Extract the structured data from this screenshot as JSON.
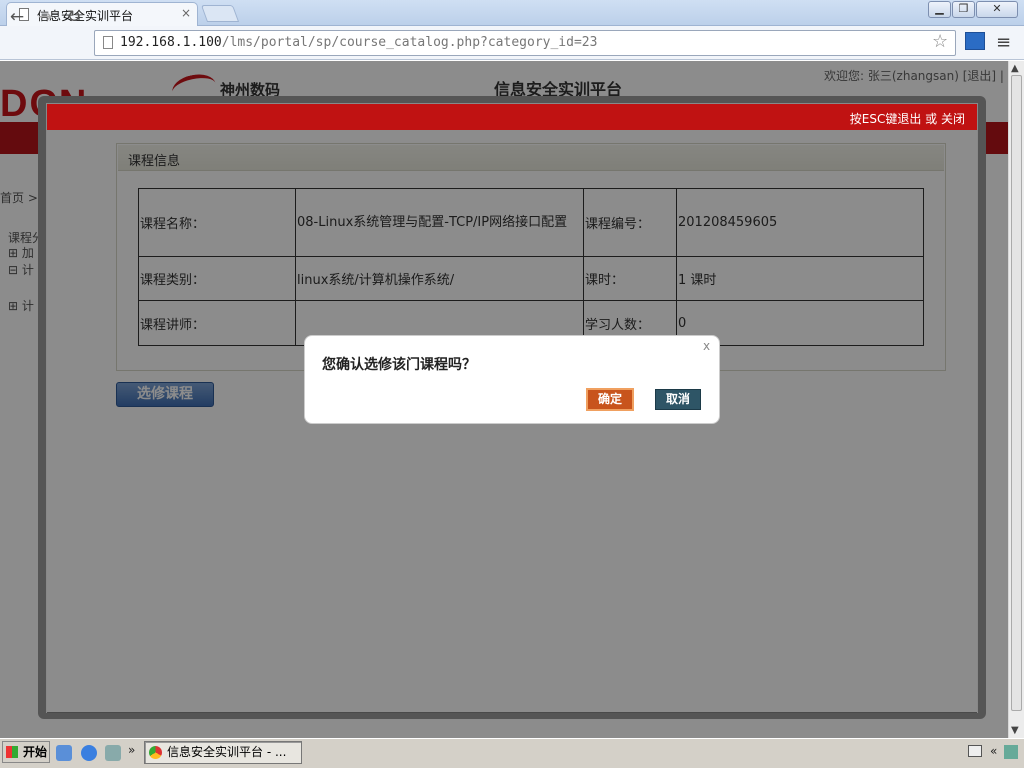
{
  "browser": {
    "tab_title": "信息安全实训平台",
    "tab_close": "×",
    "url_host": "192.168.1.100",
    "url_path": "/lms/portal/sp/course_catalog.php?category_id=23",
    "minimize": "▁",
    "maximize": "❐",
    "close": "✕"
  },
  "site": {
    "logo_text": "DCN",
    "logo_cn": "神州数码",
    "title": "信息安全实训平台",
    "welcome": "欢迎您: 张三(zhangsan) [退出] |",
    "breadcrumb": "首页 >",
    "tree": [
      "课程分",
      "⊞ 加",
      "⊟ 计",
      "⊞ 计"
    ]
  },
  "modal": {
    "header_hint": "按ESC键退出 或 关闭",
    "panel_title": "课程信息",
    "rows": [
      {
        "l1": "课程名称：",
        "v1": "08-Linux系统管理与配置-TCP/IP网络接口配置",
        "l2": "课程编号：",
        "v2": "201208459605"
      },
      {
        "l1": "课程类别：",
        "v1": "linux系统/计算机操作系统/",
        "l2": "课时：",
        "v2": "1 课时"
      },
      {
        "l1": "课程讲师：",
        "v1": "",
        "l2": "学习人数：",
        "v2": "0"
      }
    ],
    "enroll_button": "选修课程"
  },
  "confirm": {
    "question": "您确认选修该门课程吗？",
    "close": "x",
    "ok": "确定",
    "cancel": "取消"
  },
  "taskbar": {
    "start": "开始",
    "more": "»",
    "task": "信息安全实训平台 - ...",
    "tray": "« "
  }
}
